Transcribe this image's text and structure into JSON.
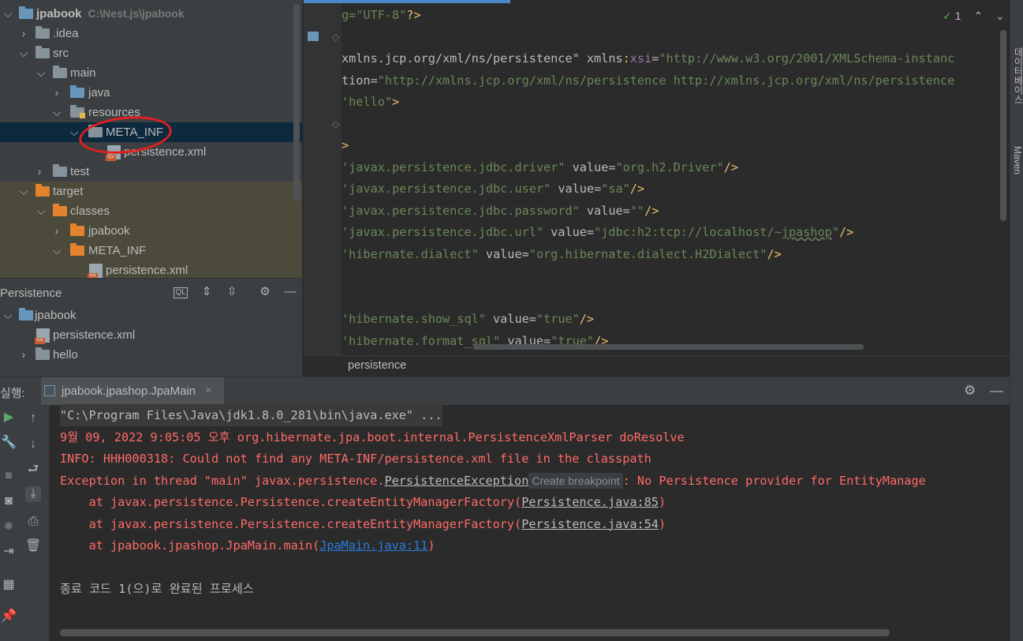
{
  "project_tree": {
    "root": {
      "label": "jpabook",
      "path": "C:\\Nest.js\\jpabook"
    },
    "items": [
      {
        "label": ".idea"
      },
      {
        "label": "src"
      },
      {
        "label": "main"
      },
      {
        "label": "java"
      },
      {
        "label": "resources"
      },
      {
        "label": "META_INF"
      },
      {
        "label": "persistence.xml"
      },
      {
        "label": "test"
      },
      {
        "label": "target"
      },
      {
        "label": "classes"
      },
      {
        "label": "jpabook"
      },
      {
        "label": "META_INF"
      },
      {
        "label": "persistence.xml"
      }
    ]
  },
  "persistence_panel": {
    "title": "Persistence",
    "items": [
      {
        "label": "jpabook"
      },
      {
        "label": "persistence.xml"
      },
      {
        "label": "hello"
      }
    ]
  },
  "editor": {
    "inspection_count": "1",
    "lines": [
      {
        "parts": [
          [
            "s",
            "g=\"UTF-8\""
          ],
          [
            "t",
            "?>"
          ]
        ]
      },
      {
        "parts": []
      },
      {
        "parts": [
          [
            "a",
            "xmlns.jcp.org/xml/ns/persistence\" "
          ],
          [
            "a",
            "xmlns"
          ],
          [
            "t",
            ":"
          ],
          [
            "ns",
            "xsi"
          ],
          [
            "a",
            "="
          ],
          [
            "s",
            "\"http://www.w3.org/2001/XMLSchema-instanc"
          ]
        ]
      },
      {
        "parts": [
          [
            "a",
            "tion="
          ],
          [
            "s",
            "\"http://xmlns.jcp.org/xml/ns/persistence http://xmlns.jcp.org/xml/ns/persistence"
          ]
        ]
      },
      {
        "parts": [
          [
            "s",
            "'hello\""
          ],
          [
            "t",
            ">"
          ]
        ]
      },
      {
        "parts": []
      },
      {
        "parts": [
          [
            "t",
            ">"
          ]
        ]
      },
      {
        "parts": [
          [
            "s",
            "'javax.persistence.jdbc.driver\""
          ],
          [
            "a",
            " value="
          ],
          [
            "s",
            "\"org.h2.Driver\""
          ],
          [
            "t",
            "/>"
          ]
        ]
      },
      {
        "parts": [
          [
            "s",
            "'javax.persistence.jdbc.user\""
          ],
          [
            "a",
            " value="
          ],
          [
            "s",
            "\"sa\""
          ],
          [
            "t",
            "/>"
          ]
        ]
      },
      {
        "parts": [
          [
            "s",
            "'javax.persistence.jdbc.password\""
          ],
          [
            "a",
            " value="
          ],
          [
            "s",
            "\"\""
          ],
          [
            "t",
            "/>"
          ]
        ]
      },
      {
        "parts": [
          [
            "s",
            "'javax.persistence.jdbc.url\""
          ],
          [
            "a",
            " value="
          ],
          [
            "s",
            "\"jdbc:h2:tcp://localhost/~jpashop\""
          ],
          [
            "t",
            "/>"
          ]
        ]
      },
      {
        "parts": [
          [
            "s",
            "'hibernate.dialect\""
          ],
          [
            "a",
            " value="
          ],
          [
            "s",
            "\"org.hibernate.dialect.H2Dialect\""
          ],
          [
            "t",
            "/>"
          ]
        ]
      },
      {
        "parts": []
      },
      {
        "parts": []
      },
      {
        "parts": [
          [
            "s",
            "'hibernate.show_sql\""
          ],
          [
            "a",
            " value="
          ],
          [
            "s",
            "\"true\""
          ],
          [
            "t",
            "/>"
          ]
        ]
      },
      {
        "parts": [
          [
            "s",
            "'hibernate.format_sql\""
          ],
          [
            "a",
            " value="
          ],
          [
            "s",
            "\"true\""
          ],
          [
            "t",
            "/>"
          ]
        ]
      }
    ],
    "breadcrumb": "persistence"
  },
  "right_strip": {
    "labels": [
      "데이터베이스",
      "Maven"
    ]
  },
  "run_panel": {
    "prefix": "실행:",
    "tab_label": "jpabook.jpashop.JpaMain",
    "console": [
      {
        "cls": "c-gray",
        "text": "\"C:\\Program Files\\Java\\jdk1.8.0_281\\bin\\java.exe\" ..."
      },
      {
        "cls": "c-red",
        "text": "9월 09, 2022 9:05:05 오후 org.hibernate.jpa.boot.internal.PersistenceXmlParser doResolve"
      },
      {
        "cls": "c-red",
        "text": "INFO: HHH000318: Could not find any META-INF/persistence.xml file in the classpath"
      },
      {
        "cls": "c-red",
        "text": "Exception in thread \"main\" javax.persistence.",
        "link": "PersistenceException",
        "chip": "Create breakpoint",
        "rest": ": No Persistence provider for EntityManage"
      },
      {
        "cls": "c-red",
        "text": "    at javax.persistence.Persistence.createEntityManagerFactory(",
        "link": "Persistence.java:85",
        "rest": ")"
      },
      {
        "cls": "c-red",
        "text": "    at javax.persistence.Persistence.createEntityManagerFactory(",
        "link": "Persistence.java:54",
        "rest": ")"
      },
      {
        "cls": "c-red",
        "text": "    at jpabook.jpashop.JpaMain.main(",
        "bluelink": "JpaMain.java:11",
        "rest": ")"
      },
      {
        "cls": "c-gray",
        "text": ""
      },
      {
        "cls": "c-gray",
        "text": "종료 코드 1(으)로 완료된 프로세스"
      }
    ]
  }
}
